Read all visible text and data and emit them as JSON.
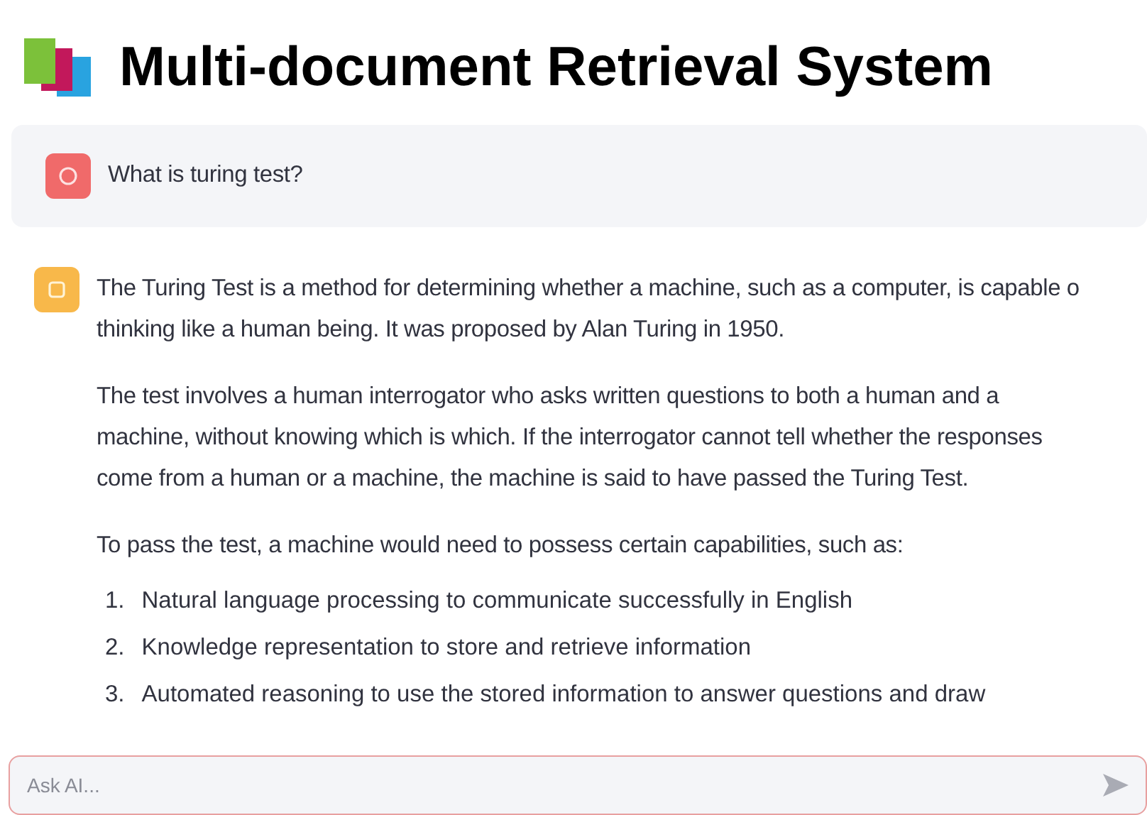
{
  "title": "Multi-document Retrieval System",
  "messages": [
    {
      "kind": "user",
      "paragraphs": [
        {
          "lines": [
            "What is turing test?"
          ]
        }
      ]
    },
    {
      "kind": "assistant",
      "paragraphs": [
        {
          "lines": [
            "The Turing Test is a method for determining whether a machine, such as a computer, is capable o",
            "thinking like a human being. It was proposed by Alan Turing in 1950."
          ]
        },
        {
          "lines": [
            "The test involves a human interrogator who asks written questions to both a human and a",
            "machine, without knowing which is which. If the interrogator cannot tell whether the responses",
            "come from a human or a machine, the machine is said to have passed the Turing Test."
          ]
        },
        {
          "lines": [
            "To pass the test, a machine would need to possess certain capabilities, such as:"
          ]
        }
      ],
      "list": [
        {
          "number": "1.",
          "text": "Natural language processing to communicate successfully in English"
        },
        {
          "number": "2.",
          "text": "Knowledge representation to store and retrieve information"
        },
        {
          "number": "3.",
          "text": "Automated reasoning to use the stored information to answer questions and draw"
        }
      ]
    }
  ],
  "input": {
    "placeholder": "Ask AI..."
  }
}
